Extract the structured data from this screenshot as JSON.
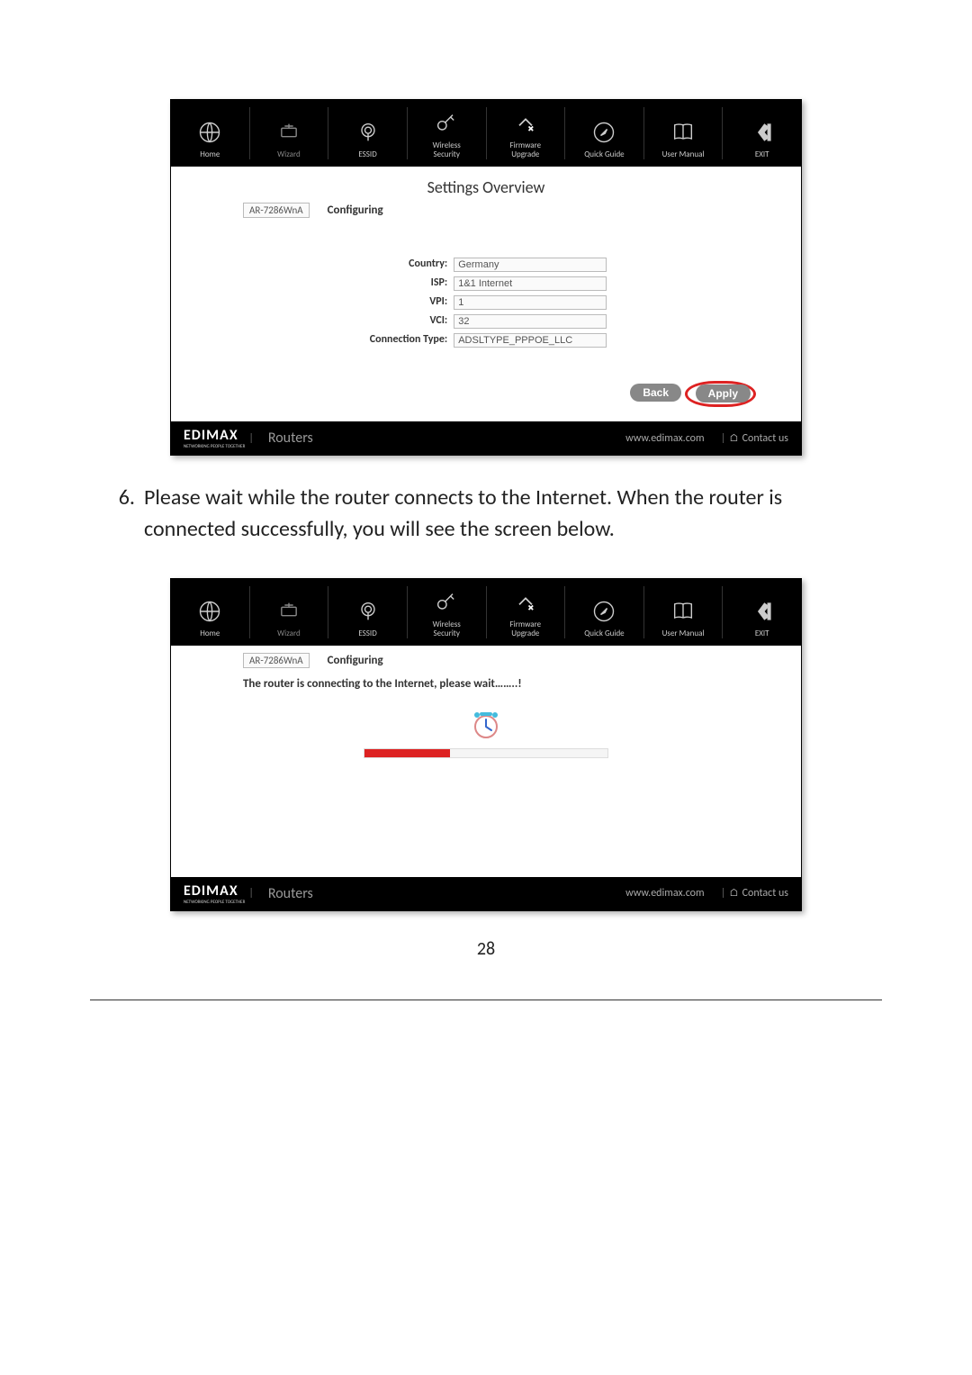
{
  "nav": [
    {
      "label": "Home"
    },
    {
      "label": "Wizard"
    },
    {
      "label": "ESSID"
    },
    {
      "label": "Wireless\nSecurity"
    },
    {
      "label": "Firmware\nUpgrade"
    },
    {
      "label": "Quick Guide"
    },
    {
      "label": "User Manual"
    },
    {
      "label": "EXIT"
    }
  ],
  "overview": {
    "title": "Settings Overview",
    "model": "AR-7286WnA",
    "status": "Configuring",
    "fields": {
      "country_label": "Country:",
      "country_value": "Germany",
      "isp_label": "ISP:",
      "isp_value": "1&1 Internet",
      "vpi_label": "VPI:",
      "vpi_value": "1",
      "vci_label": "VCI:",
      "vci_value": "32",
      "conn_label": "Connection Type:",
      "conn_value": "ADSLTYPE_PPPOE_LLC"
    },
    "back": "Back",
    "apply": "Apply"
  },
  "instruction": {
    "number": "6.",
    "text": "Please wait while the router connects to the Internet. When the router is connected successfully, you will see the screen below."
  },
  "connecting": {
    "model": "AR-7286WnA",
    "status": "Configuring",
    "message": "The router is connecting to the Internet, please wait……..!"
  },
  "footer": {
    "brand": "EDIMAX",
    "tag": "NETWORKING PEOPLE TOGETHER",
    "routers": "Routers",
    "url": "www.edimax.com",
    "contact": "Contact us"
  },
  "page_number": "28"
}
